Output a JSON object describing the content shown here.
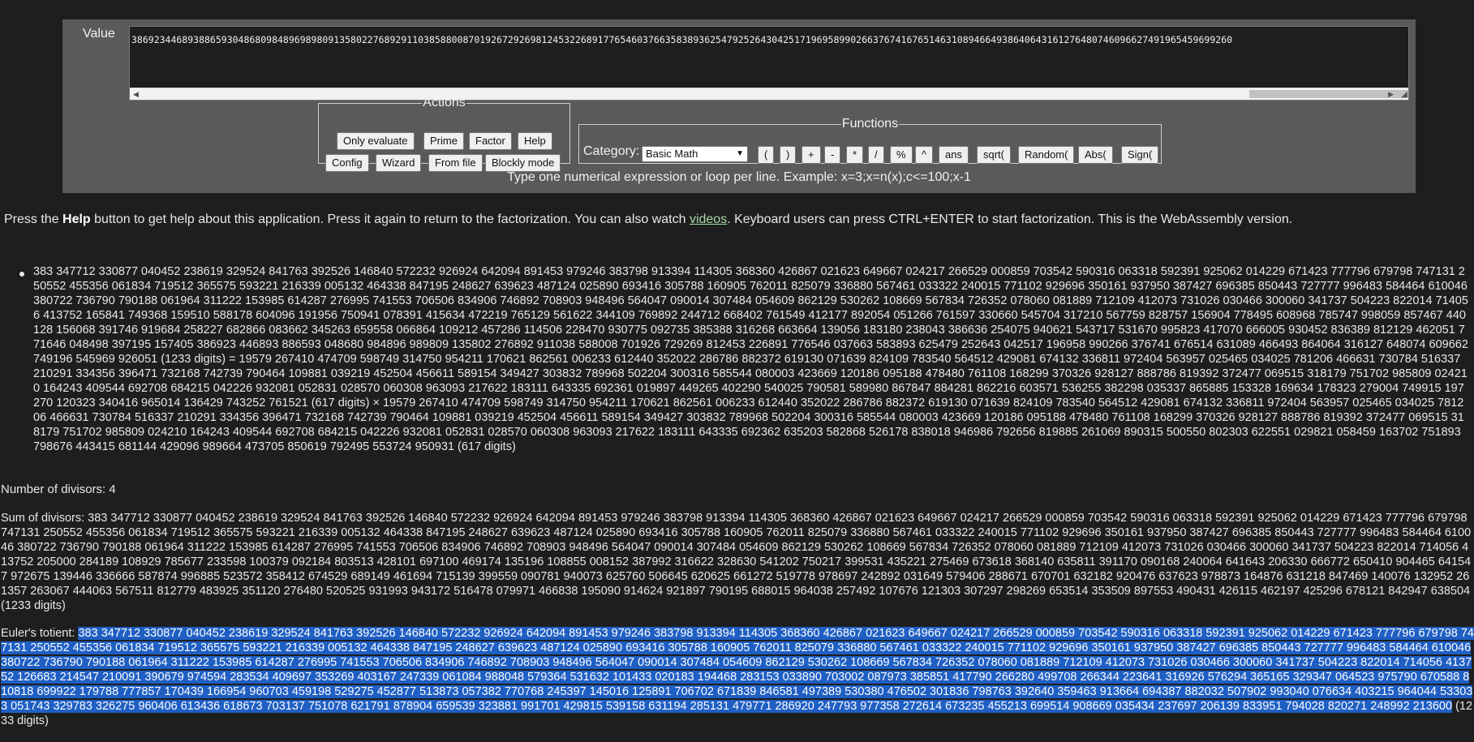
{
  "value_label": "Value",
  "value_text": "3869234468938865930486809848969898091358022768929110385880087019267292698124532268917765460376635838936254792526430425171969589902663767416765146310894664938640643161276480746096627491965459699260",
  "actions": {
    "legend": "Actions",
    "buttons": [
      "Only evaluate",
      "Prime",
      "Factor",
      "Help",
      "Config",
      "Wizard",
      "From file",
      "Blockly mode"
    ]
  },
  "functions": {
    "legend": "Functions",
    "category_label": "Category:",
    "category_value": "Basic Math",
    "buttons": [
      "(",
      ")",
      "+",
      "-",
      "*",
      "/",
      "%",
      "^",
      "ans",
      "sqrt(",
      "Random(",
      "Abs(",
      "Sign("
    ]
  },
  "hint": "Type one numerical expression or loop per line. Example: x=3;x=n(x);c<=100;x-1",
  "help_line": {
    "t1": "Press the ",
    "bold": "Help",
    "t2": " button to get help about this application. Press it again to return to the factorization. You can also watch ",
    "link": "videos",
    "t3": ". Keyboard users can press CTRL+ENTER to start factorization. This is the WebAssembly version."
  },
  "factorization": "383 347712 330877 040452 238619 329524 841763 392526 146840 572232 926924 642094 891453 979246 383798 913394 114305 368360 426867 021623 649667 024217 266529 000859 703542 590316 063318 592391 925062 014229 671423 777796 679798 747131 250552 455356 061834 719512 365575 593221 216339 005132 464338 847195 248627 639623 487124 025890 693416 305788 160905 762011 825079 336880 567461 033322 240015 771102 929696 350161 937950 387427 696385 850443 727777 996483 584464 610046 380722 736790 790188 061964 311222 153985 614287 276995 741553 706506 834906 746892 708903 948496 564047 090014 307484 054609 862129 530262 108669 567834 726352 078060 081889 712109 412073 731026 030466 300060 341737 504223 822014 714056 413752 165841 749368 159510 588178 604096 191956 750941 078391 415634 472219 765129 561622 344109 769892 244712 668402 761549 412177 892054 051266 761597 330660 545704 317210 567759 828757 156904 778495 608968 785747 998059 857467 440128 156068 391746 919684 258227 682866 083662 345263 659558 066864 109212 457286 114506 228470 930775 092735 385388 316268 663664 139056 183180 238043 386636 254075 940621 543717 531670 995823 417070 666005 930452 836389 812129 462051 771646 048498 397195 157405 386923 446893 886593 048680 984896 989809 135802 276892 911038 588008 701926 729269 812453 226891 776546 037663 583893 625479 252643 042517 196958 990266 376741 676514 631089 466493 864064 316127 648074 609662 749196 545969 926051 (1233 digits) = 19579 267410 474709 598749 314750 954211 170621 862561 006233 612440 352022 286786 882372 619130 071639 824109 783540 564512 429081 674132 336811 972404 563957 025465 034025 781206 466631 730784 516337 210291 334356 396471 732168 742739 790464 109881 039219 452504 456611 589154 349427 303832 789968 502204 300316 585544 080003 423669 120186 095188 478480 761108 168299 370326 928127 888786 819392 372477 069515 318179 751702 985809 024210 164243 409544 692708 684215 042226 932081 052831 028570 060308 963093 217622 183111 643335 692361 019897 449265 402290 540025 790581 589980 867847 884281 862216 603571 536255 382298 035337 865885 153328 169634 178323 279004 749915 197270 120323 340416 965014 136429 743252 761521 (617 digits) × 19579 267410 474709 598749 314750 954211 170621 862561 006233 612440 352022 286786 882372 619130 071639 824109 783540 564512 429081 674132 336811 972404 563957 025465 034025 781206 466631 730784 516337 210291 334356 396471 732168 742739 790464 109881 039219 452504 456611 589154 349427 303832 789968 502204 300316 585544 080003 423669 120186 095188 478480 761108 168299 370326 928127 888786 819392 372477 069515 318179 751702 985809 024210 164243 409544 692708 684215 042226 932081 052831 028570 060308 963093 217622 183111 643335 692362 635203 582868 526178 838018 946986 792656 819885 261069 890315 500550 802303 622551 029821 058459 163702 751893 798676 443415 681144 429096 989664 473705 850619 792495 553724 950931 (617 digits)",
  "divisors_line": "Number of divisors: 4",
  "sum_label": "Sum of divisors: ",
  "sum_value": "383 347712 330877 040452 238619 329524 841763 392526 146840 572232 926924 642094 891453 979246 383798 913394 114305 368360 426867 021623 649667 024217 266529 000859 703542 590316 063318 592391 925062 014229 671423 777796 679798 747131 250552 455356 061834 719512 365575 593221 216339 005132 464338 847195 248627 639623 487124 025890 693416 305788 160905 762011 825079 336880 567461 033322 240015 771102 929696 350161 937950 387427 696385 850443 727777 996483 584464 610046 380722 736790 790188 061964 311222 153985 614287 276995 741553 706506 834906 746892 708903 948496 564047 090014 307484 054609 862129 530262 108669 567834 726352 078060 081889 712109 412073 731026 030466 300060 341737 504223 822014 714056 413752 205000 284189 108929 785677 233598 100379 092184 803513 428101 697100 469174 135196 108855 008152 387992 316622 328630 541202 750217 399531 435221 275469 673618 368140 635811 391170 090168 240064 641643 206330 666772 650410 904465 641547 972675 139446 336666 587874 996885 523572 358412 674529 689149 461694 715139 399559 090781 940073 625760 506645 620625 661272 519778 978697 242892 031649 579406 288671 670701 632182 920476 637623 978873 164876 631218 847469 140076 132952 261357 263067 444063 567511 812779 483925 351120 276480 520525 931993 943172 516478 079971 466838 195090 914624 921897 790195 688015 964038 257492 107676 121303 307297 298269 653514 353509 897553 490431 426115 462197 425296 678121 842947 638504 (1233 digits)",
  "euler_label": "Euler's totient: ",
  "euler_value": "383 347712 330877 040452 238619 329524 841763 392526 146840 572232 926924 642094 891453 979246 383798 913394 114305 368360 426867 021623 649667 024217 266529 000859 703542 590316 063318 592391 925062 014229 671423 777796 679798 747131 250552 455356 061834 719512 365575 593221 216339 005132 464338 847195 248627 639623 487124 025890 693416 305788 160905 762011 825079 336880 567461 033322 240015 771102 929696 350161 937950 387427 696385 850443 727777 996483 584464 610046 380722 736790 790188 061964 311222 153985 614287 276995 741553 706506 834906 746892 708903 948496 564047 090014 307484 054609 862129 530262 108669 567834 726352 078060 081889 712109 412073 731026 030466 300060 341737 504223 822014 714056 413752 126683 214547 210091 390679 974594 283534 409697 353269 403167 247339 061084 988048 579364 531632 101433 020183 194468 283153 033890 703002 087973 385851 417790 266280 499708 266344 223641 316926 576294 365165 329347 064523 975790 670588 810818 699922 179788 777857 170439 166954 960703 459198 529275 452877 513873 057382 770768 245397 145016 125891 706702 671839 846581 497389 530380 476502 301836 798763 392640 359463 913664 694387 882032 507902 993040 076634 403215 964044 533033 051743 329783 326275 960406 613436 618673 703137 751078 621791 878904 659539 323881 991701 429815 539158 631194 285131 479771 286920 247793 977358 272614 673235 455213 699514 908669 035434 237697 206139 833951 794028 820271 248992 213600",
  "euler_digits": " (1233 digits)"
}
